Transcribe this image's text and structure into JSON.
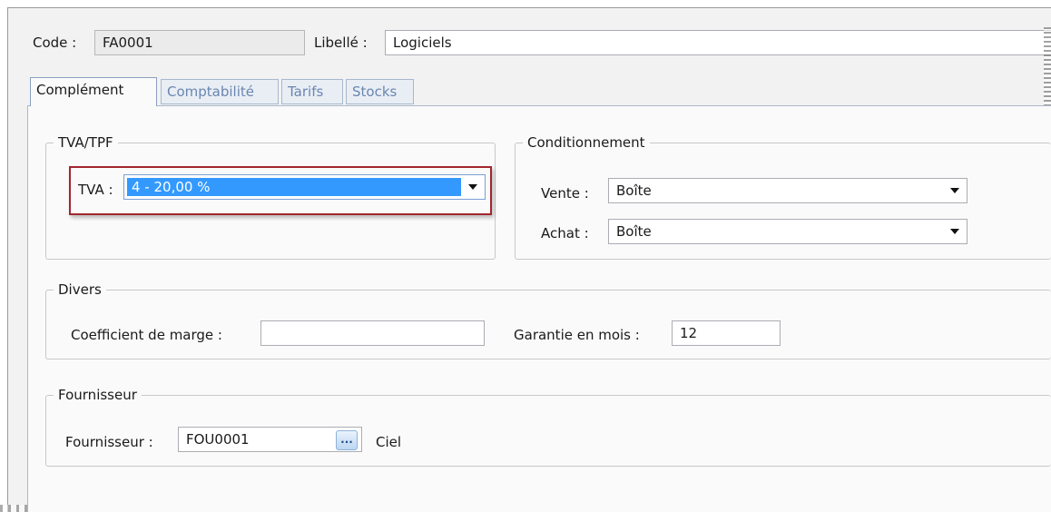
{
  "header": {
    "code_label": "Code :",
    "code_value": "FA0001",
    "libelle_label": "Libellé :",
    "libelle_value": "Logiciels"
  },
  "tabs": [
    {
      "label": "Complément",
      "active": true
    },
    {
      "label": "Comptabilité",
      "active": false
    },
    {
      "label": "Tarifs",
      "active": false
    },
    {
      "label": "Stocks",
      "active": false
    }
  ],
  "tva_group": {
    "legend": "TVA/TPF",
    "tva_label": "TVA :",
    "tva_value": "4 - 20,00 %"
  },
  "conditionnement_group": {
    "legend": "Conditionnement",
    "vente_label": "Vente :",
    "vente_value": "Boîte",
    "achat_label": "Achat :",
    "achat_value": "Boîte"
  },
  "divers_group": {
    "legend": "Divers",
    "coef_label": "Coefficient de marge :",
    "coef_value": "",
    "garantie_label": "Garantie en mois :",
    "garantie_value": "12"
  },
  "fournisseur_group": {
    "legend": "Fournisseur",
    "fournisseur_label": "Fournisseur :",
    "fournisseur_value": "FOU0001",
    "browse_label": "...",
    "fournisseur_name": "Ciel"
  },
  "colors": {
    "selection": "#3399ff",
    "highlight_border": "#a3262e",
    "tab_inactive_text": "#6a86b0"
  }
}
